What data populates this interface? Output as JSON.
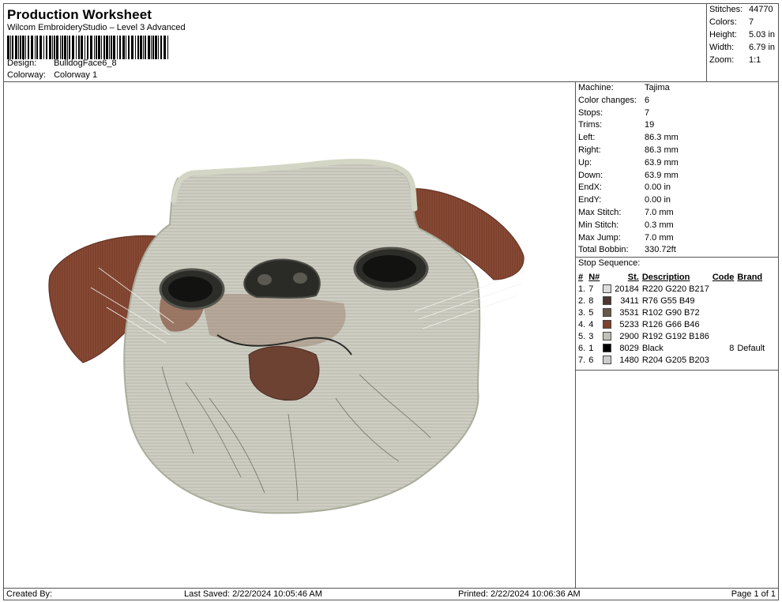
{
  "header": {
    "title": "Production Worksheet",
    "subtitle": "Wilcom EmbroideryStudio – Level 3 Advanced",
    "design_label": "Design:",
    "design_value": "BulldogFace6_8",
    "colorway_label": "Colorway:",
    "colorway_value": "Colorway 1"
  },
  "stats": [
    {
      "label": "Stitches:",
      "value": "44770"
    },
    {
      "label": "Colors:",
      "value": "7"
    },
    {
      "label": "Height:",
      "value": "5.03 in"
    },
    {
      "label": "Width:",
      "value": "6.79 in"
    },
    {
      "label": "Zoom:",
      "value": "1:1"
    }
  ],
  "details": [
    {
      "label": "Machine:",
      "value": "Tajima"
    },
    {
      "label": "Color changes:",
      "value": "6"
    },
    {
      "label": "Stops:",
      "value": "7"
    },
    {
      "label": "Trims:",
      "value": "19"
    },
    {
      "label": "Left:",
      "value": "86.3 mm"
    },
    {
      "label": "Right:",
      "value": "86.3 mm"
    },
    {
      "label": "Up:",
      "value": "63.9 mm"
    },
    {
      "label": "Down:",
      "value": "63.9 mm"
    },
    {
      "label": "EndX:",
      "value": "0.00 in"
    },
    {
      "label": "EndY:",
      "value": "0.00 in"
    },
    {
      "label": "Max Stitch:",
      "value": "7.0 mm"
    },
    {
      "label": "Min Stitch:",
      "value": "0.3 mm"
    },
    {
      "label": "Max Jump:",
      "value": "7.0 mm"
    },
    {
      "label": "Total Bobbin:",
      "value": "330.72ft"
    }
  ],
  "stop_sequence": {
    "title": "Stop Sequence:",
    "columns": {
      "stop": "#",
      "needle": "N#",
      "stitches": "St.",
      "description": "Description",
      "code": "Code",
      "brand": "Brand"
    },
    "rows": [
      {
        "stop": "1.",
        "needle": "7",
        "color": "#dcdcd9",
        "stitches": "20184",
        "description": "R220 G220 B217",
        "code": "",
        "brand": ""
      },
      {
        "stop": "2.",
        "needle": "8",
        "color": "#4c3731",
        "stitches": "3411",
        "description": "R76 G55 B49",
        "code": "",
        "brand": ""
      },
      {
        "stop": "3.",
        "needle": "5",
        "color": "#665a48",
        "stitches": "3531",
        "description": "R102 G90 B72",
        "code": "",
        "brand": ""
      },
      {
        "stop": "4.",
        "needle": "4",
        "color": "#7e422e",
        "stitches": "5233",
        "description": "R126 G66 B46",
        "code": "",
        "brand": ""
      },
      {
        "stop": "5.",
        "needle": "3",
        "color": "#c0c0ba",
        "stitches": "2900",
        "description": "R192 G192 B186",
        "code": "",
        "brand": ""
      },
      {
        "stop": "6.",
        "needle": "1",
        "color": "#000000",
        "stitches": "8029",
        "description": "Black",
        "code": "8",
        "brand": "Default"
      },
      {
        "stop": "7.",
        "needle": "6",
        "color": "#cccdcb",
        "stitches": "1480",
        "description": "R204 G205 B203",
        "code": "",
        "brand": ""
      }
    ]
  },
  "footer": {
    "created_by": "Created By:",
    "last_saved": "Last Saved: 2/22/2024 10:05:46 AM",
    "printed": "Printed: 2/22/2024 10:06:36 AM",
    "page": "Page 1 of 1"
  },
  "design_colors": {
    "fur": "#c8c9bd",
    "fur_light": "#d8d9cf",
    "outline": "#b9bcac",
    "ear": "#7e422e",
    "dark": "#2a2a27",
    "nose_brown": "#6e4233"
  },
  "icons": {
    "design": "bulldog-face-embroidery"
  }
}
